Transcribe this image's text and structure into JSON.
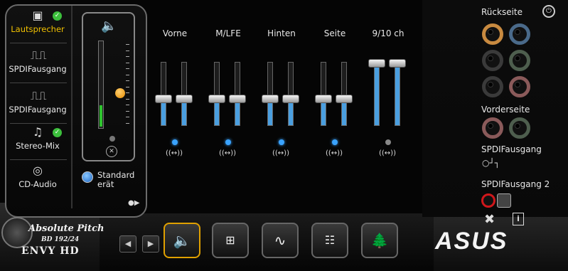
{
  "devices": [
    {
      "label": "Lautsprecher",
      "icon": "speaker-icon",
      "checked": true,
      "selected": true
    },
    {
      "label": "SPDIFausgang",
      "icon": "digital-wave-icon",
      "checked": false,
      "selected": false
    },
    {
      "label": "SPDIFausgang",
      "icon": "digital-wave-icon",
      "checked": false,
      "selected": false
    },
    {
      "label": "Stereo-Mix",
      "icon": "music-note-icon",
      "checked": true,
      "selected": false
    },
    {
      "label": "CD-Audio",
      "icon": "cd-icon",
      "checked": false,
      "selected": false
    }
  ],
  "standard": {
    "label_line1": "Standard",
    "label_line2": "erät"
  },
  "channels": [
    {
      "label": "Vorne",
      "level": 0.43
    },
    {
      "label": "M/LFE",
      "level": 0.43
    },
    {
      "label": "Hinten",
      "level": 0.43
    },
    {
      "label": "Seite",
      "level": 0.43
    },
    {
      "label": "9/10 ch",
      "level": 1.0
    }
  ],
  "link_symbol": "((↔))",
  "right": {
    "rear_label": "Rückseite",
    "front_label": "Vorderseite",
    "spdif_label": "SPDIFausgang",
    "spdif2_label": "SPDIFausgang 2"
  },
  "branding": {
    "line1": "Absolute Pitch",
    "line2": "BD 192/24",
    "line3": "ENVY HD",
    "asus": "ASUS"
  },
  "colors": {
    "accent_yellow": "#f0c000",
    "slider_blue": "#4a9fe0",
    "master_green": "#2ec42e"
  }
}
